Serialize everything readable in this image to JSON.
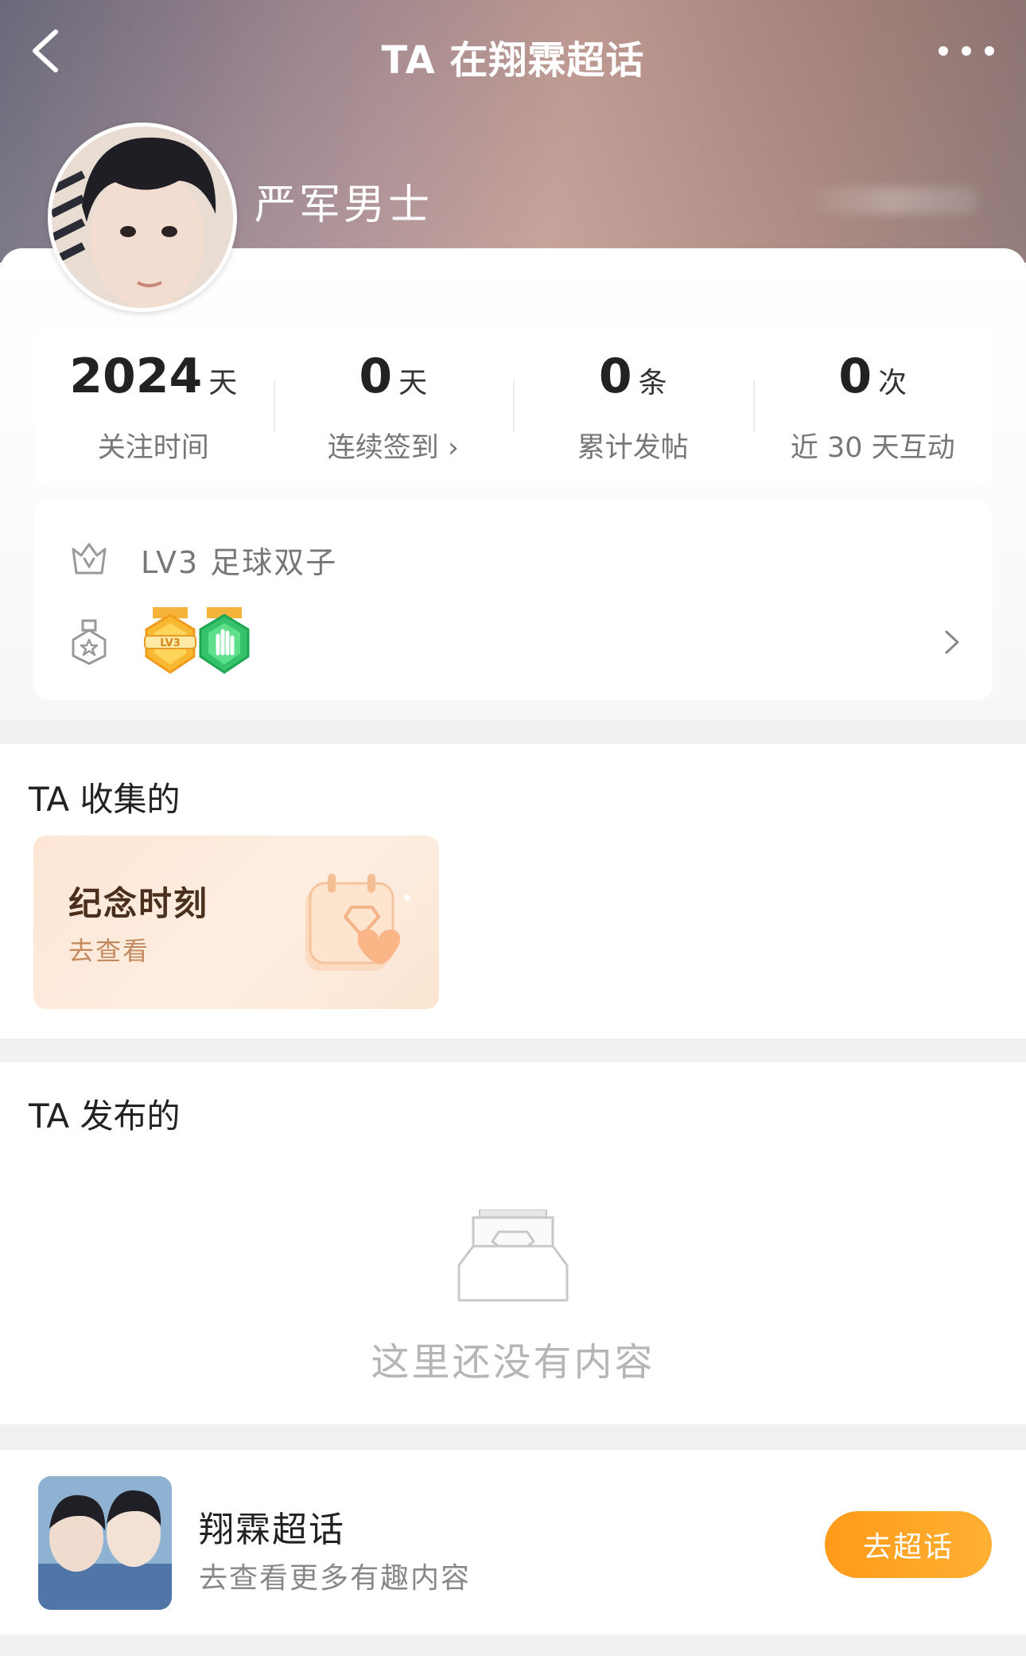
{
  "header": {
    "title": "TA 在翔霖超话",
    "username": "严军男士"
  },
  "stats": [
    {
      "value": "2024",
      "unit": "天",
      "label": "关注时间"
    },
    {
      "value": "0",
      "unit": "天",
      "label": "连续签到 ›"
    },
    {
      "value": "0",
      "unit": "条",
      "label": "累计发帖"
    },
    {
      "value": "0",
      "unit": "次",
      "label": "近 30 天互动"
    }
  ],
  "level": {
    "text": "LV3  足球双子",
    "medals": [
      "lv3-medal",
      "hand-medal"
    ],
    "medal_label": "LV3"
  },
  "collected": {
    "title": "TA 收集的",
    "card_title": "纪念时刻",
    "card_sub": "去查看"
  },
  "posted": {
    "title": "TA 发布的",
    "empty_text": "这里还没有内容"
  },
  "topic": {
    "name": "翔霖超话",
    "sub": "去查看更多有趣内容",
    "button": "去超话"
  },
  "colors": {
    "accent": "#ff9f1f",
    "hero_start": "#6f6e80",
    "hero_end": "#c59f97"
  }
}
